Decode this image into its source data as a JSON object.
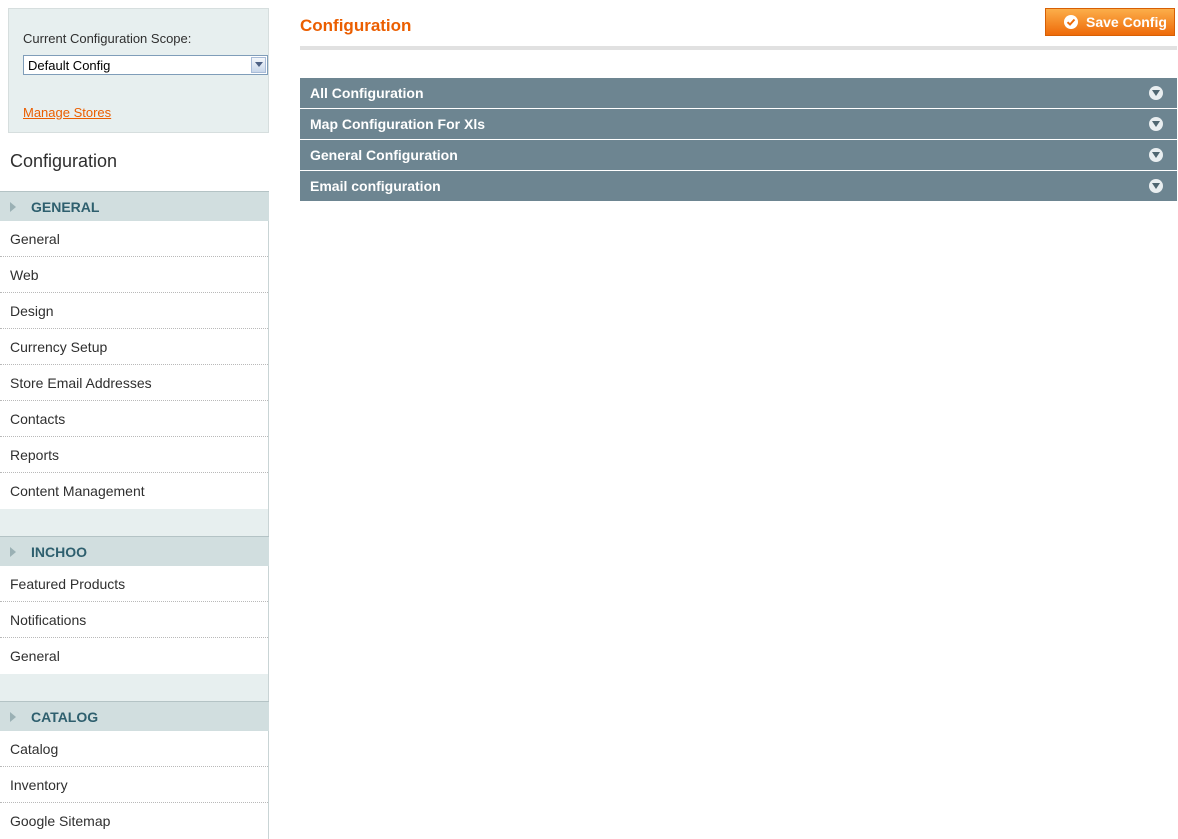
{
  "scope": {
    "label": "Current Configuration Scope:",
    "selected": "Default Config",
    "manage_stores": "Manage Stores"
  },
  "sidebar": {
    "title": "Configuration",
    "groups": [
      {
        "label": "GENERAL",
        "items": [
          "General",
          "Web",
          "Design",
          "Currency Setup",
          "Store Email Addresses",
          "Contacts",
          "Reports",
          "Content Management"
        ]
      },
      {
        "label": "INCHOO",
        "items": [
          "Featured Products",
          "Notifications",
          "General"
        ]
      },
      {
        "label": "CATALOG",
        "items": [
          "Catalog",
          "Inventory",
          "Google Sitemap"
        ]
      }
    ]
  },
  "main": {
    "title": "Configuration",
    "save_label": "Save Config",
    "sections": [
      "All Configuration",
      "Map Configuration For Xls",
      "General Configuration",
      "Email configuration"
    ]
  },
  "icons": {
    "select_arrow": "chevron-down-icon",
    "group_arrow": "triangle-right-icon",
    "save": "check-circle-icon",
    "section_toggle": "expand-circle-icon"
  },
  "colors": {
    "accent": "#eb5e00",
    "section_bar": "#6d8591",
    "group_head": "#d1dedf",
    "panel_bg": "#e7efef"
  }
}
